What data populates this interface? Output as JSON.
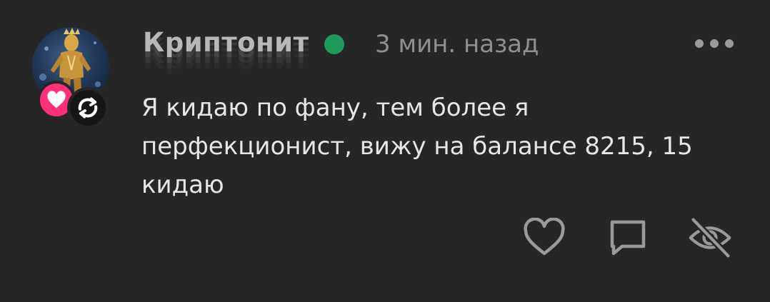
{
  "comment": {
    "author": "Криптонит",
    "online_status_color": "#1f9a5a",
    "time": "3 мин. назад",
    "text_lines": [
      "Я кидаю по фану, тем более я",
      "перфекционист, вижу на балансе 8215, 15",
      "кидаю"
    ],
    "badges": [
      "heart-icon",
      "sync-icon"
    ],
    "actions": [
      "heart-outline-icon",
      "comment-icon",
      "eye-off-icon"
    ],
    "more_icon": "more-dots-icon"
  },
  "colors": {
    "background": "#262626",
    "text": "#e6e6e6",
    "muted": "#8f8f8f",
    "badge_pink": "#ff2f7c"
  }
}
